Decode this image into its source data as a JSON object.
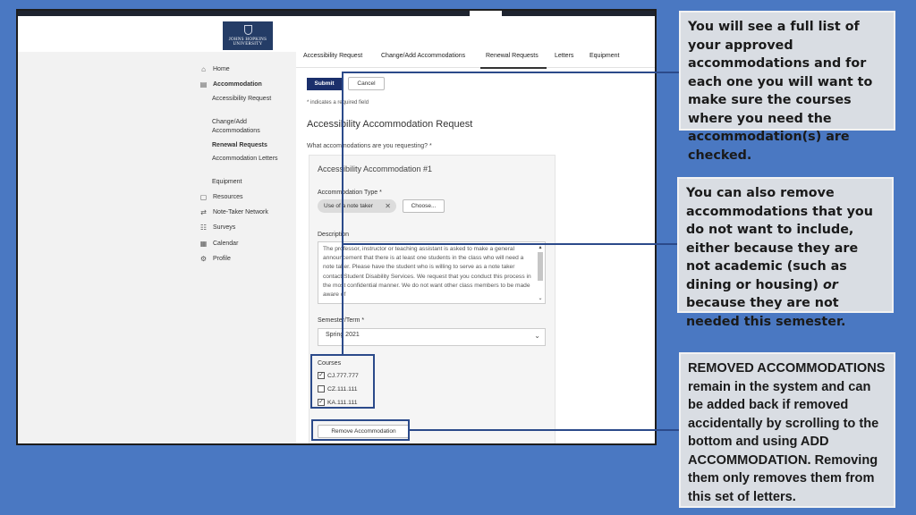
{
  "header": {
    "logo_text": "JOHNS HOPKINS UNIVERSITY"
  },
  "sidebar": {
    "items": [
      {
        "label": "Home",
        "icon": "home-icon"
      },
      {
        "label": "Accommodation",
        "icon": "list-icon"
      },
      {
        "label": "Resources",
        "icon": "book-icon"
      },
      {
        "label": "Note-Taker Network",
        "icon": "share-icon"
      },
      {
        "label": "Surveys",
        "icon": "people-icon"
      },
      {
        "label": "Calendar",
        "icon": "calendar-icon"
      },
      {
        "label": "Profile",
        "icon": "gear-icon"
      }
    ],
    "sub_items": [
      "Accessibility Request",
      "Change/Add Accommodations",
      "Renewal Requests",
      "Accommodation Letters",
      "Equipment"
    ]
  },
  "tabs": [
    "Accessibility Request",
    "Change/Add Accommodations",
    "Renewal Requests",
    "Letters",
    "Equipment"
  ],
  "form": {
    "submit_label": "Submit",
    "cancel_label": "Cancel",
    "required_note": "* indicates a required field",
    "title": "Accessibility Accommodation Request",
    "question": "What accommodations are you requesting? *",
    "card_title": "Accessibility Accommodation #1",
    "type_label": "Accommodation Type *",
    "type_value": "Use of a note taker",
    "choose_label": "Choose...",
    "description_label": "Description",
    "description_text": "The professor, instructor or teaching assistant is asked to make a general announcement that there is at least one students in the class who will need a note taker. Please have the student who is willing to serve as a note taker contact Student Disability Services. We request that you conduct this process in the most confidential manner. We do not want other class members to be made aware of",
    "term_label": "Semester/Term *",
    "term_value": "Spring 2021",
    "courses_label": "Courses",
    "courses": [
      {
        "code": "CJ.777.777",
        "checked": true
      },
      {
        "code": "CZ.111.111",
        "checked": false
      },
      {
        "code": "KA.111.111",
        "checked": true
      }
    ],
    "remove_label": "Remove Accommodation"
  },
  "callouts": {
    "c1": "You will see a full list of your approved accommodations and for each one you will want to make sure the courses where you need the accommodation(s) are checked.",
    "c2_a": "You can also remove accommodations that you do not want to include, either because they are not academic (such as dining or housing) ",
    "c2_or": "or",
    "c2_b": " because they are not needed this semester.",
    "c3": "REMOVED ACCOMMODATIONS remain in the system and can be added back if removed accidentally by scrolling to the bottom and using ADD ACCOMMODATION. Removing them only removes them from this set of letters."
  },
  "colors": {
    "background": "#4a78c2",
    "accent": "#1b2f6b",
    "highlight": "#2b4a8a"
  }
}
